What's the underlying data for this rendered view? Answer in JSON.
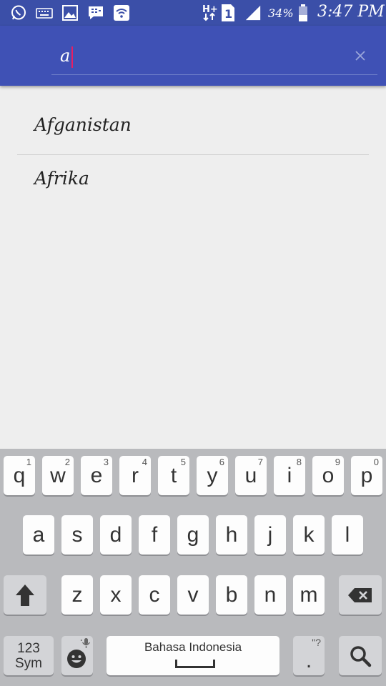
{
  "status_bar": {
    "icons": [
      "whatsapp-icon",
      "keyboard-icon",
      "gallery-icon",
      "bbm-icon",
      "wifi-icon",
      "hplus-network-icon",
      "sim1-icon",
      "signal-icon",
      "battery-icon"
    ],
    "network": "H+",
    "sim": "1",
    "battery": "34%",
    "time": "3:47 PM"
  },
  "search": {
    "value": "a"
  },
  "results": [
    {
      "label": "Afganistan"
    },
    {
      "label": "Afrika"
    }
  ],
  "keyboard": {
    "row1": [
      {
        "main": "q",
        "hint": "1"
      },
      {
        "main": "w",
        "hint": "2"
      },
      {
        "main": "e",
        "hint": "3"
      },
      {
        "main": "r",
        "hint": "4"
      },
      {
        "main": "t",
        "hint": "5"
      },
      {
        "main": "y",
        "hint": "6"
      },
      {
        "main": "u",
        "hint": "7"
      },
      {
        "main": "i",
        "hint": "8"
      },
      {
        "main": "o",
        "hint": "9"
      },
      {
        "main": "p",
        "hint": "0"
      }
    ],
    "row2": [
      "a",
      "s",
      "d",
      "f",
      "g",
      "h",
      "j",
      "k",
      "l"
    ],
    "row3": [
      "z",
      "x",
      "c",
      "v",
      "b",
      "n",
      "m"
    ],
    "sym_line1": "123",
    "sym_line2": "Sym",
    "space_label": "Bahasa Indonesia",
    "period": ".",
    "period_hint": "\"?",
    "icons": [
      "shift-icon",
      "backspace-icon",
      "emoji-icon",
      "mic-icon",
      "search-icon"
    ]
  },
  "colors": {
    "status_bar": "#3b4fa8",
    "app_bar": "#3f51b5",
    "cursor": "#e91e63",
    "background": "#eeeeee",
    "keyboard": "#b9babd"
  }
}
